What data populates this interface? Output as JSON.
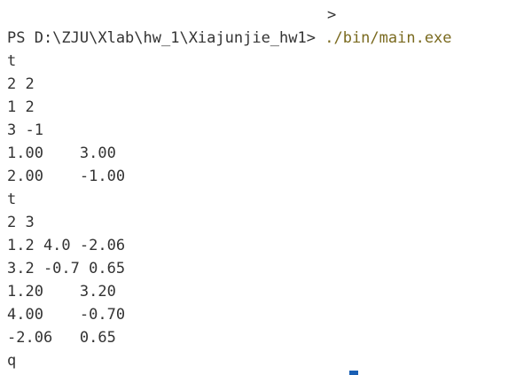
{
  "terminal": {
    "top_arrow": ">",
    "prompt": "PS D:\\ZJU\\Xlab\\hw_1\\Xiajunjie_hw1> ",
    "command": "./bin/main.exe",
    "lines": [
      "t",
      "2 2",
      "1 2",
      "3 -1",
      "1.00    3.00",
      "2.00    -1.00",
      "t",
      "2 3",
      "1.2 4.0 -2.06",
      "3.2 -0.7 0.65",
      "1.20    3.20",
      "4.00    -0.70",
      "-2.06   0.65",
      "q"
    ],
    "colors": {
      "background": "#ffffff",
      "text": "#333333",
      "command": "#7a6a1f",
      "cursor": "#1a5fb4"
    }
  }
}
